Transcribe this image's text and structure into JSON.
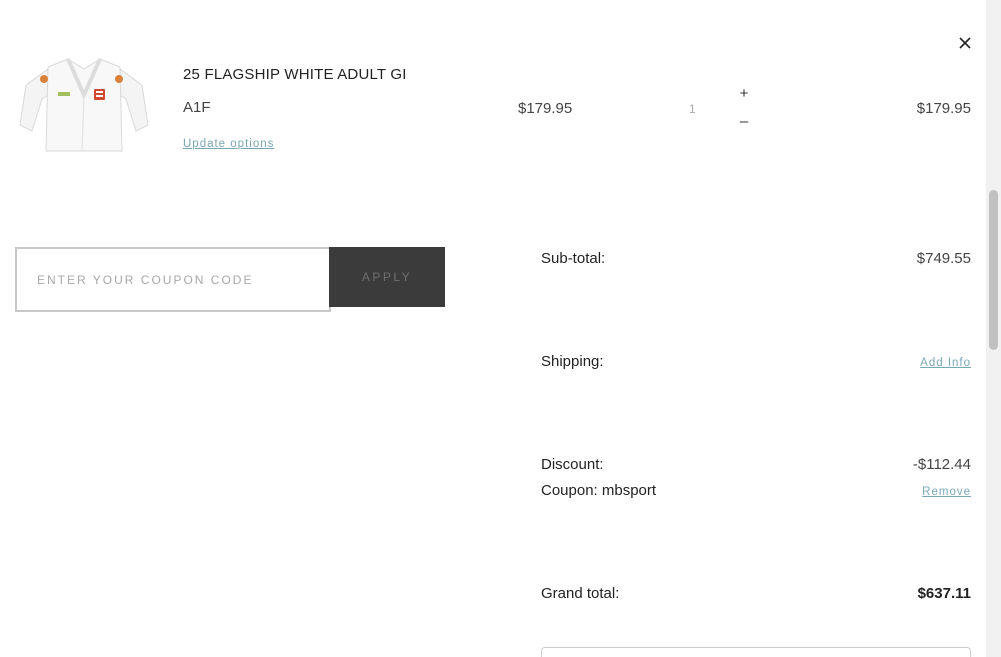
{
  "cart_item": {
    "name": "25 FLAGSHIP WHITE ADULT GI",
    "sku": "A1F",
    "update_label": "Update options",
    "unit_price": "$179.95",
    "quantity": "1",
    "plus_label": "+",
    "minus_label": "–",
    "line_total": "$179.95",
    "image_icon": "white-gi-jacket"
  },
  "coupon": {
    "placeholder": "ENTER YOUR COUPON CODE",
    "value": "",
    "apply_label": "APPLY"
  },
  "summary": {
    "subtotal_label": "Sub-total:",
    "subtotal_value": "$749.55",
    "shipping_label": "Shipping:",
    "shipping_link": "Add Info",
    "discount_label": "Discount:",
    "discount_value": "-$112.44",
    "coupon_label": "Coupon: mbsport",
    "coupon_remove": "Remove",
    "grand_label": "Grand total:",
    "grand_value": "$637.11"
  },
  "icons": {
    "close": "close-icon"
  },
  "colors": {
    "link": "#7aa7b5",
    "apply_button": "#3b3b3b",
    "text": "#222222"
  }
}
